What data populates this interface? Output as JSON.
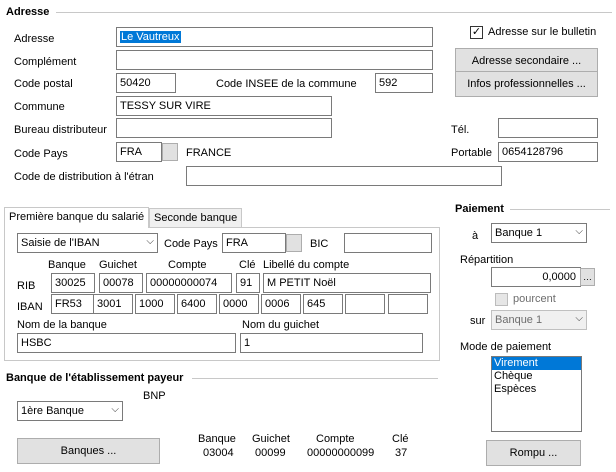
{
  "adresse_section": {
    "title": "Adresse",
    "labels": {
      "adresse": "Adresse",
      "complement": "Complément",
      "code_postal": "Code postal",
      "code_insee": "Code INSEE de la commune",
      "commune": "Commune",
      "bureau": "Bureau distributeur",
      "code_pays": "Code Pays",
      "code_distribution": "Code de distribution à l'étran",
      "tel": "Tél.",
      "portable": "Portable"
    },
    "values": {
      "adresse": "Le Vautreux",
      "complement": "",
      "code_postal": "50420",
      "code_insee": "592",
      "commune": "TESSY SUR VIRE",
      "bureau": "",
      "code_pays": "FRA",
      "pays_name": "FRANCE",
      "code_distribution": "",
      "tel": "",
      "portable": "0654128796"
    },
    "checkbox_bulletin": "Adresse sur le bulletin",
    "btn_secondaire": "Adresse secondaire ...",
    "btn_infos": "Infos professionnelles ..."
  },
  "banque_tabs": {
    "tab1": "Première banque du salarié",
    "tab2": "Seconde banque"
  },
  "banque1": {
    "saisie": "Saisie de l'IBAN",
    "code_pays_label": "Code Pays",
    "code_pays": "FRA",
    "bic_label": "BIC",
    "bic": "",
    "headers": {
      "banque": "Banque",
      "guichet": "Guichet",
      "compte": "Compte",
      "cle": "Clé",
      "libelle": "Libellé du compte"
    },
    "rib_label": "RIB",
    "rib": {
      "banque": "30025",
      "guichet": "00078",
      "compte": "00000000074",
      "cle": "91",
      "libelle": "M PETIT Noël"
    },
    "iban_label": "IBAN",
    "iban": [
      "FR53",
      "3001",
      "1000",
      "6400",
      "0000",
      "0006",
      "645",
      "",
      ""
    ],
    "nom_banque_label": "Nom de la banque",
    "nom_banque": "HSBC",
    "nom_guichet_label": "Nom du guichet",
    "nom_guichet": "1"
  },
  "paiement": {
    "title": "Paiement",
    "a_label": "à",
    "a_value": "Banque 1",
    "repartition_label": "Répartition",
    "repartition_value": "0,0000",
    "pourcent_label": "pourcent",
    "sur_label": "sur",
    "sur_value": "Banque 1",
    "mode_label": "Mode de paiement",
    "modes": [
      "Virement",
      "Chèque",
      "Espèces"
    ],
    "selected_mode": "Virement"
  },
  "etablissement": {
    "title": "Banque de l'établissement payeur",
    "select": "1ère Banque",
    "bank_name": "BNP",
    "btn_banques": "Banques ...",
    "headers": {
      "banque": "Banque",
      "guichet": "Guichet",
      "compte": "Compte",
      "cle": "Clé"
    },
    "values": {
      "banque": "03004",
      "guichet": "00099",
      "compte": "00000000099",
      "cle": "37"
    },
    "btn_rompu": "Rompu ..."
  }
}
